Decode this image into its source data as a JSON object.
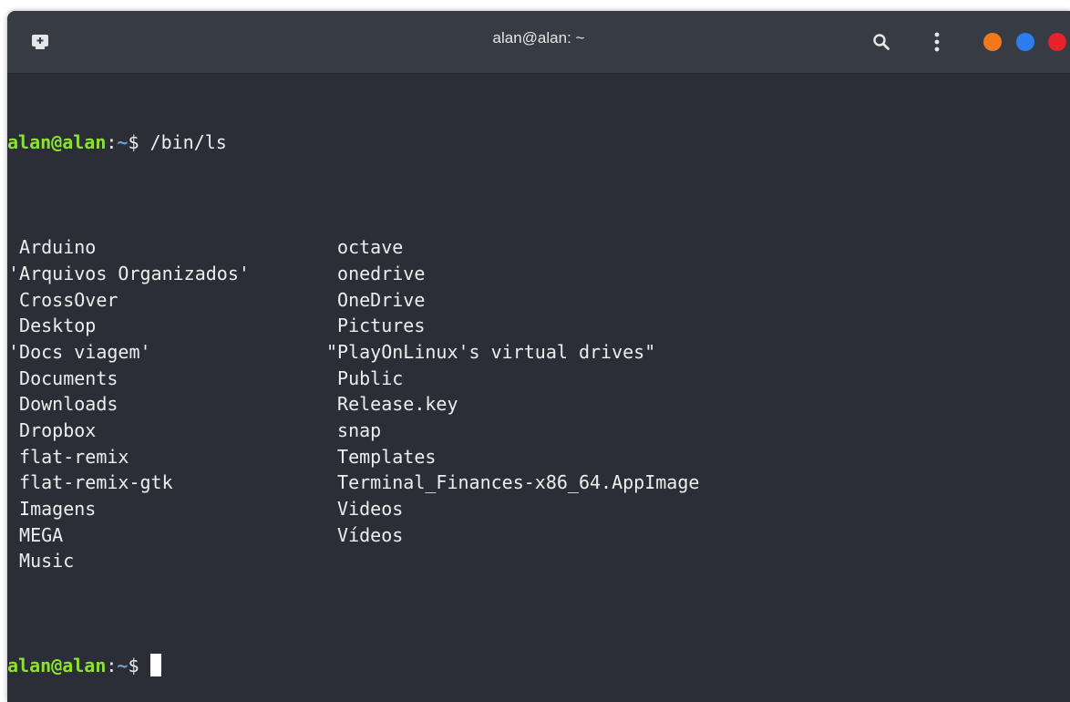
{
  "window": {
    "title": "alan@alan: ~"
  },
  "icons": {
    "new_tab": "new-tab-icon",
    "search": "search-icon",
    "menu": "kebab-menu-icon"
  },
  "window_controls": {
    "minimize_color": "#f07a1b",
    "maximize_color": "#2d7cf0",
    "close_color": "#e8222a"
  },
  "prompt": {
    "user_host": "alan@alan",
    "colon": ":",
    "path": "~",
    "symbol": "$ "
  },
  "command": "/bin/ls",
  "listing": {
    "left": [
      " Arduino",
      "'Arquivos Organizados'",
      " CrossOver",
      " Desktop",
      "'Docs viagem'",
      " Documents",
      " Downloads",
      " Dropbox",
      " flat-remix",
      " flat-remix-gtk",
      " Imagens",
      " MEGA",
      " Music"
    ],
    "right": [
      " octave",
      " onedrive",
      " OneDrive",
      " Pictures",
      "\"PlayOnLinux's virtual drives\"",
      " Public",
      " Release.key",
      " snap",
      " Templates",
      " Terminal_Finances-x86_64.AppImage",
      " Videos",
      " Vídeos",
      ""
    ]
  },
  "colors": {
    "prompt_user": "#8ae234",
    "prompt_path": "#729fcf",
    "terminal_bg": "#2b2e36",
    "titlebar_bg": "#373b43"
  }
}
